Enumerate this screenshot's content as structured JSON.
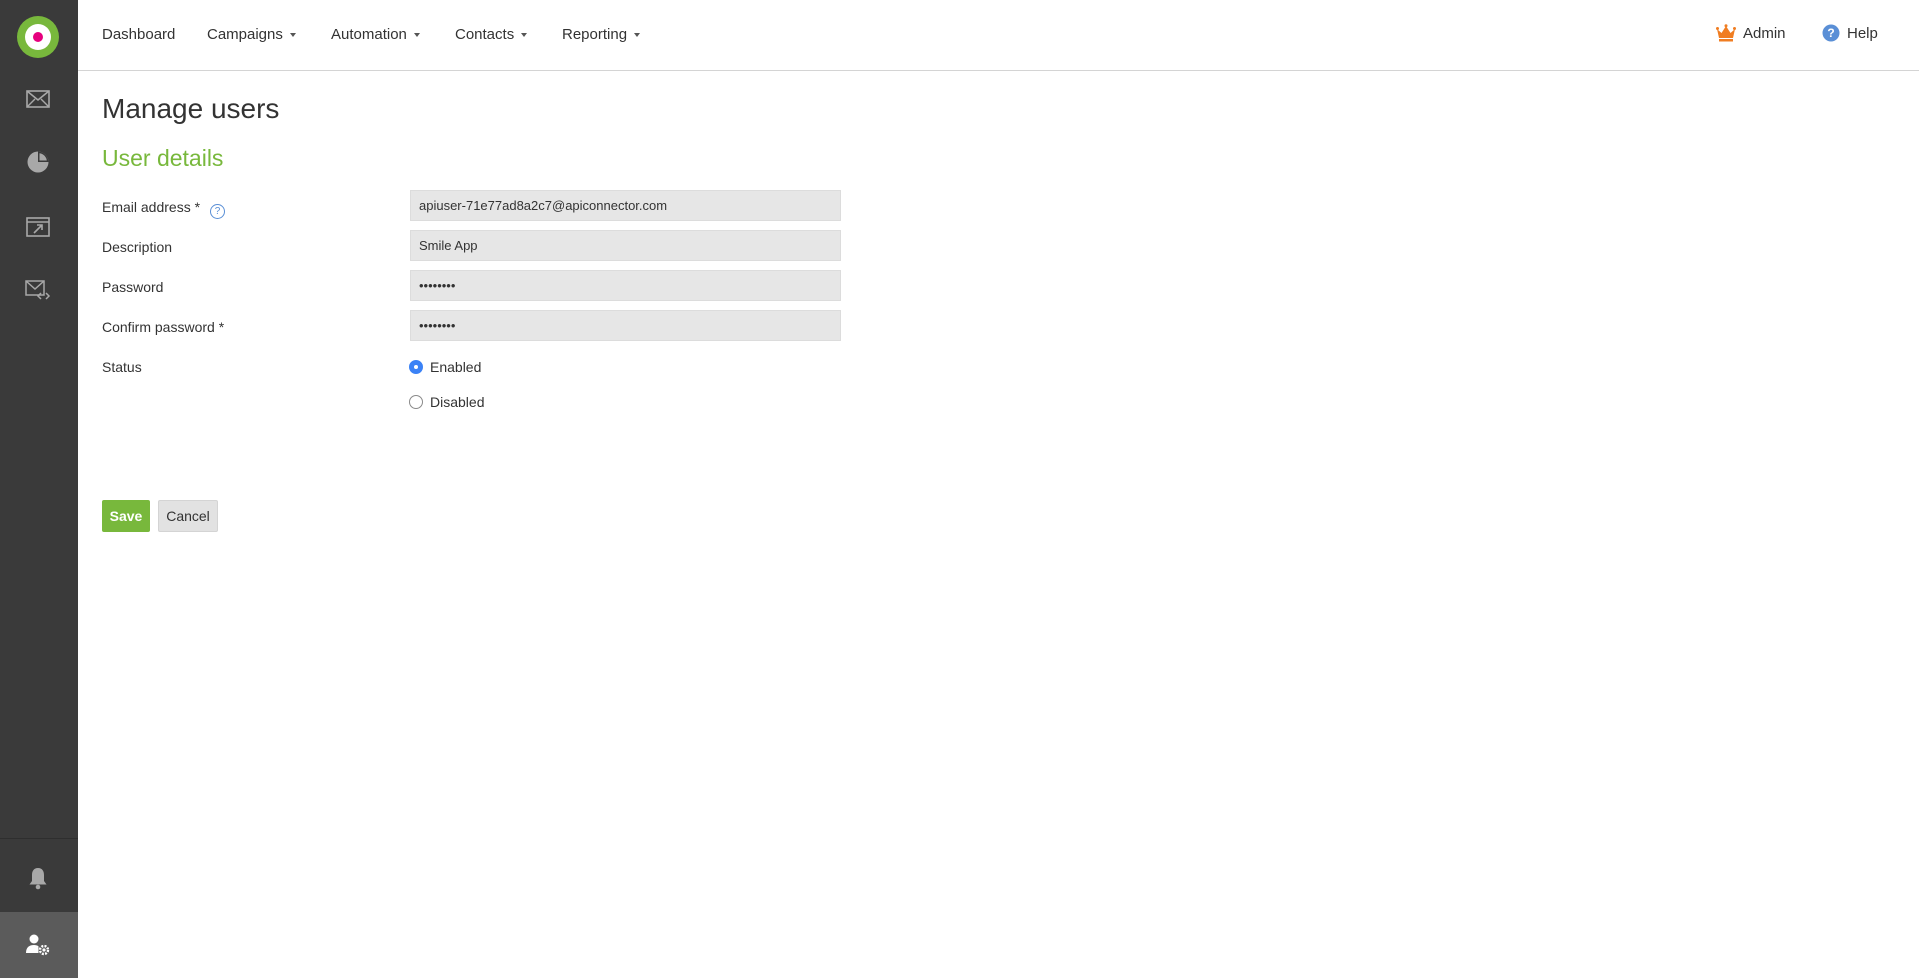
{
  "nav": {
    "items": [
      {
        "label": "Dashboard",
        "has_caret": false
      },
      {
        "label": "Campaigns",
        "has_caret": true
      },
      {
        "label": "Automation",
        "has_caret": true
      },
      {
        "label": "Contacts",
        "has_caret": true
      },
      {
        "label": "Reporting",
        "has_caret": true
      }
    ],
    "admin_label": "Admin",
    "help_label": "Help"
  },
  "sidebar": {
    "icons": [
      "logo",
      "mail-icon",
      "pie-chart-icon",
      "calendar-icon",
      "transactional-email-icon",
      "bell-icon",
      "user-settings-icon"
    ],
    "active": "user-settings-icon"
  },
  "page": {
    "title": "Manage users",
    "section_title": "User details"
  },
  "form": {
    "email_label": "Email address *",
    "email_value": "apiuser-71e77ad8a2c7@apiconnector.com",
    "description_label": "Description",
    "description_value": "Smile App",
    "password_label": "Password",
    "password_value": "••••••••",
    "confirm_label": "Confirm password *",
    "confirm_value": "••••••••",
    "status_label": "Status",
    "status_options": [
      "Enabled",
      "Disabled"
    ],
    "status_selected": "Enabled",
    "help_glyph": "?"
  },
  "buttons": {
    "save": "Save",
    "cancel": "Cancel"
  },
  "colors": {
    "accent_green": "#78b83c",
    "sidebar_bg": "#3a3a3a",
    "logo_dot": "#e6007e",
    "admin_icon": "#f07d22",
    "help_icon": "#5a8fd6"
  }
}
